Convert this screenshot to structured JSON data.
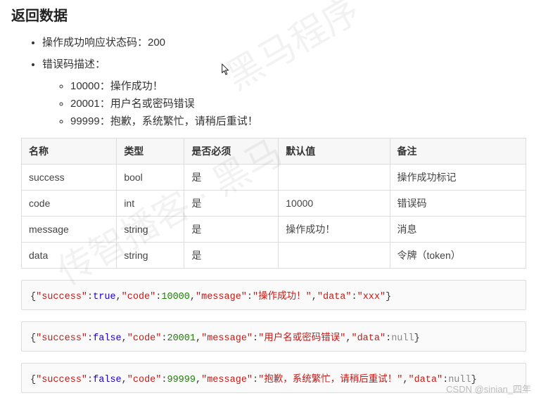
{
  "watermark1": "黑马程序",
  "watermark2": "传智播客 · 黑马",
  "attribution": "CSDN @sinian_四年",
  "title": "返回数据",
  "status_line": "操作成功响应状态码：200",
  "error_label": "错误码描述：",
  "errors": [
    {
      "code": "10000",
      "text": "：操作成功！"
    },
    {
      "code": "20001",
      "text": "：用户名或密码错误"
    },
    {
      "code": "99999",
      "text": "：抱歉，系统繁忙，请稍后重试！"
    }
  ],
  "table": {
    "headers": [
      "名称",
      "类型",
      "是否必须",
      "默认值",
      "备注"
    ],
    "rows": [
      [
        "success",
        "bool",
        "是",
        "",
        "操作成功标记"
      ],
      [
        "code",
        "int",
        "是",
        "10000",
        "错误码"
      ],
      [
        "message",
        "string",
        "是",
        "操作成功！",
        "消息"
      ],
      [
        "data",
        "string",
        "是",
        "",
        "令牌（token）"
      ]
    ]
  },
  "code1": {
    "success": "true",
    "code": "10000",
    "msg": "操作成功！",
    "data_key": "data",
    "data_val": "\"xxx\""
  },
  "code2": {
    "success": "false",
    "code": "20001",
    "msg": "用户名或密码错误",
    "data_key": "data",
    "data_val": "null"
  },
  "code3": {
    "success": "false",
    "code": "99999",
    "msg": "抱歉，系统繁忙，请稍后重试！",
    "data_key": "data",
    "data_val": "null"
  }
}
